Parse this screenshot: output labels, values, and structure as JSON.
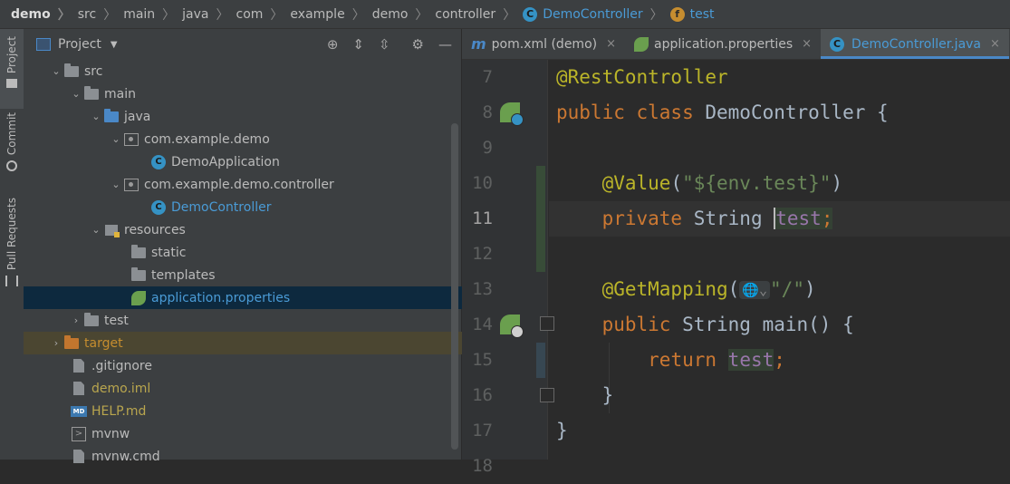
{
  "breadcrumb": {
    "items": [
      "demo",
      "src",
      "main",
      "java",
      "com",
      "example",
      "demo",
      "controller",
      "DemoController",
      "test"
    ],
    "class_badge": "C",
    "field_badge": "f"
  },
  "side_tabs": [
    "Project",
    "Commit",
    "Pull Requests"
  ],
  "project_panel": {
    "title": "Project",
    "tree": [
      {
        "label": "src"
      },
      {
        "label": "main"
      },
      {
        "label": "java"
      },
      {
        "label": "com.example.demo"
      },
      {
        "label": "DemoApplication"
      },
      {
        "label": "com.example.demo.controller"
      },
      {
        "label": "DemoController"
      },
      {
        "label": "resources"
      },
      {
        "label": "static"
      },
      {
        "label": "templates"
      },
      {
        "label": "application.properties"
      },
      {
        "label": "test"
      },
      {
        "label": "target"
      },
      {
        "label": ".gitignore"
      },
      {
        "label": "demo.iml"
      },
      {
        "label": "HELP.md"
      },
      {
        "label": "mvnw"
      },
      {
        "label": "mvnw.cmd"
      }
    ],
    "class_letter": "C",
    "md_label": "MD",
    "terminal_glyph": ">"
  },
  "editor": {
    "tabs": [
      {
        "label": "pom.xml (demo)",
        "icon": "m"
      },
      {
        "label": "application.properties"
      },
      {
        "label": "DemoController.java",
        "active": true
      }
    ],
    "close_glyph": "×",
    "line_numbers": [
      "7",
      "8",
      "9",
      "10",
      "11",
      "12",
      "13",
      "14",
      "15",
      "16",
      "17",
      "18"
    ],
    "code": {
      "l7_annotation": "@RestController",
      "l8_kw": "public class ",
      "l8_rest": "DemoController {",
      "l10_annotation": "@Value",
      "l10_open": "(",
      "l10_string": "\"${env.test}\"",
      "l10_close": ")",
      "l11_kw": "private ",
      "l11_type": "String ",
      "l11_field": "test",
      "l11_end": ";",
      "l13_annotation": "@GetMapping",
      "l13_open": "(",
      "l13_inlay": "🌐⌄",
      "l13_string": "\"/\"",
      "l13_close": ")",
      "l14_kw": "public ",
      "l14_rest": "String main() {",
      "l15_kw": "return ",
      "l15_field": "test",
      "l15_end": ";",
      "l16_brace": "}",
      "l17_brace": "}"
    }
  },
  "colors": {
    "background": "#2b2b2b",
    "panel": "#3c3f41",
    "keyword": "#cc7832",
    "annotation": "#bbb529",
    "string": "#6a8759",
    "field": "#9876aa",
    "selection": "#0d293e"
  }
}
